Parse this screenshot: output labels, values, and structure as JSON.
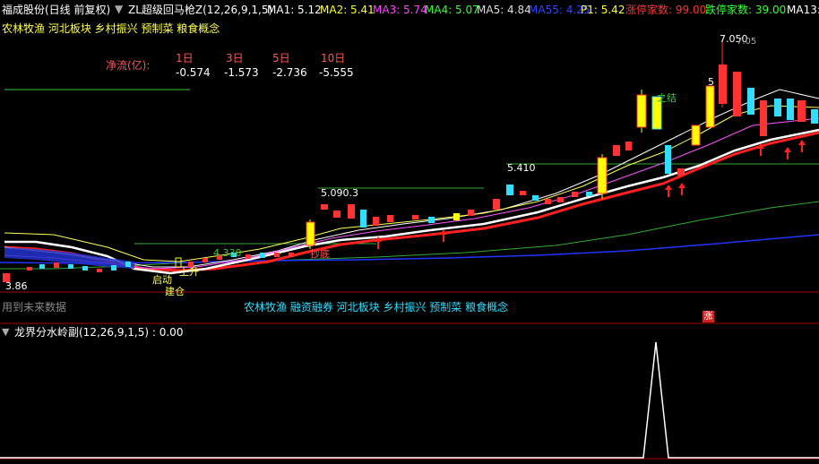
{
  "header": {
    "stock_label": "福成股份(日线 前复权)",
    "formula_label": "ZL超级回马枪Z(12,26,9,1,5)",
    "ma1": "MA1: 5.12",
    "ma2": "MA2: 5.41",
    "ma3": "MA3: 5.74",
    "ma4": "MA4: 5.07",
    "ma5": "MA5: 4.84",
    "ma55": "MA55: 4.25",
    "p1": "P1: 5.42",
    "limit_up": "涨停家数: 99.00",
    "limit_down": "跌停家数: 39.00",
    "ma13": "MA13:"
  },
  "concepts_top": "农林牧渔 河北板块 乡村振兴 预制菜 粮食概念",
  "net_flow": {
    "label": "净流(亿):",
    "periods": [
      {
        "head": "1日",
        "value": "-0.574"
      },
      {
        "head": "3日",
        "value": "-1.573"
      },
      {
        "head": "5日",
        "value": "-2.736"
      },
      {
        "head": "10日",
        "value": "-5.555"
      }
    ]
  },
  "chart_notes": {
    "high": "7.050",
    "high2": "7.05",
    "level_5410": "5.410",
    "level_5090": "5.090.3",
    "level_4330": "4.330",
    "low": "3.86",
    "zhi": "之结",
    "five": "5",
    "entry": "抄底",
    "rise": "上升",
    "start": "启动",
    "build": "建仓"
  },
  "future_note": "用到未来数据",
  "concepts_bottom": "农林牧渔 融资融券 河北板块 乡村振兴 预制菜 粮食概念",
  "limit_badge": "涨",
  "sub_panel": {
    "title": "龙界分水岭副(12,26,9,1,5) : 0.00"
  },
  "colors": {
    "up": "#ff3333",
    "down": "#33ddff",
    "yellow": "#ffff00",
    "ma_white": "#ffffff",
    "ma_red": "#ff2020",
    "ma_green": "#33aa33",
    "ma_blue": "#2233ff",
    "panel_border": "#aa0000"
  }
}
